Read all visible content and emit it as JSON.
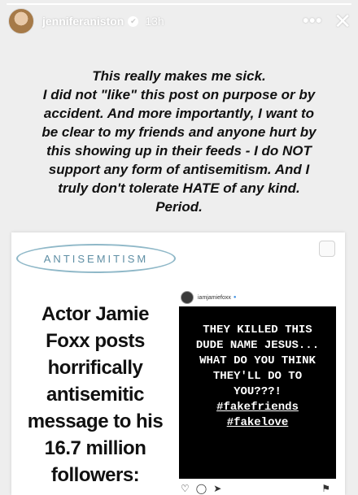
{
  "story": {
    "progress": 1.0,
    "username": "jenniferaniston",
    "timestamp": "13h",
    "verified_glyph": "✔",
    "more_glyph": "•••",
    "close_glyph": "✕"
  },
  "statement": {
    "lines": [
      "This really makes me sick.",
      "I did not \"like\" this post on purpose or by",
      "accident. And more importantly, I want to",
      "be clear to my friends and anyone hurt by",
      "this showing up in their feeds - I do NOT",
      "support any form of antisemitism. And I",
      "truly don't tolerate HATE of any kind.",
      "Period."
    ]
  },
  "article": {
    "tag": "ANTISEMITISM",
    "headline_lines": [
      "Actor Jamie",
      "Foxx posts",
      "horrifically",
      "antisemitic",
      "message to his",
      "16.7 million",
      "followers:"
    ],
    "embedded_post": {
      "handle": "iamjamiefoxx",
      "verified_glyph": "●",
      "text_lines": [
        "THEY KILLED THIS",
        "DUDE NAME JESUS...",
        "WHAT DO YOU THINK",
        "THEY'LL DO TO",
        "YOU???!"
      ],
      "hashtags": [
        "#fakefriends",
        "#fakelove"
      ],
      "actions": {
        "like_glyph": "♡",
        "comment_glyph": "◯",
        "share_glyph": "➤",
        "save_glyph": "⚑"
      }
    }
  }
}
